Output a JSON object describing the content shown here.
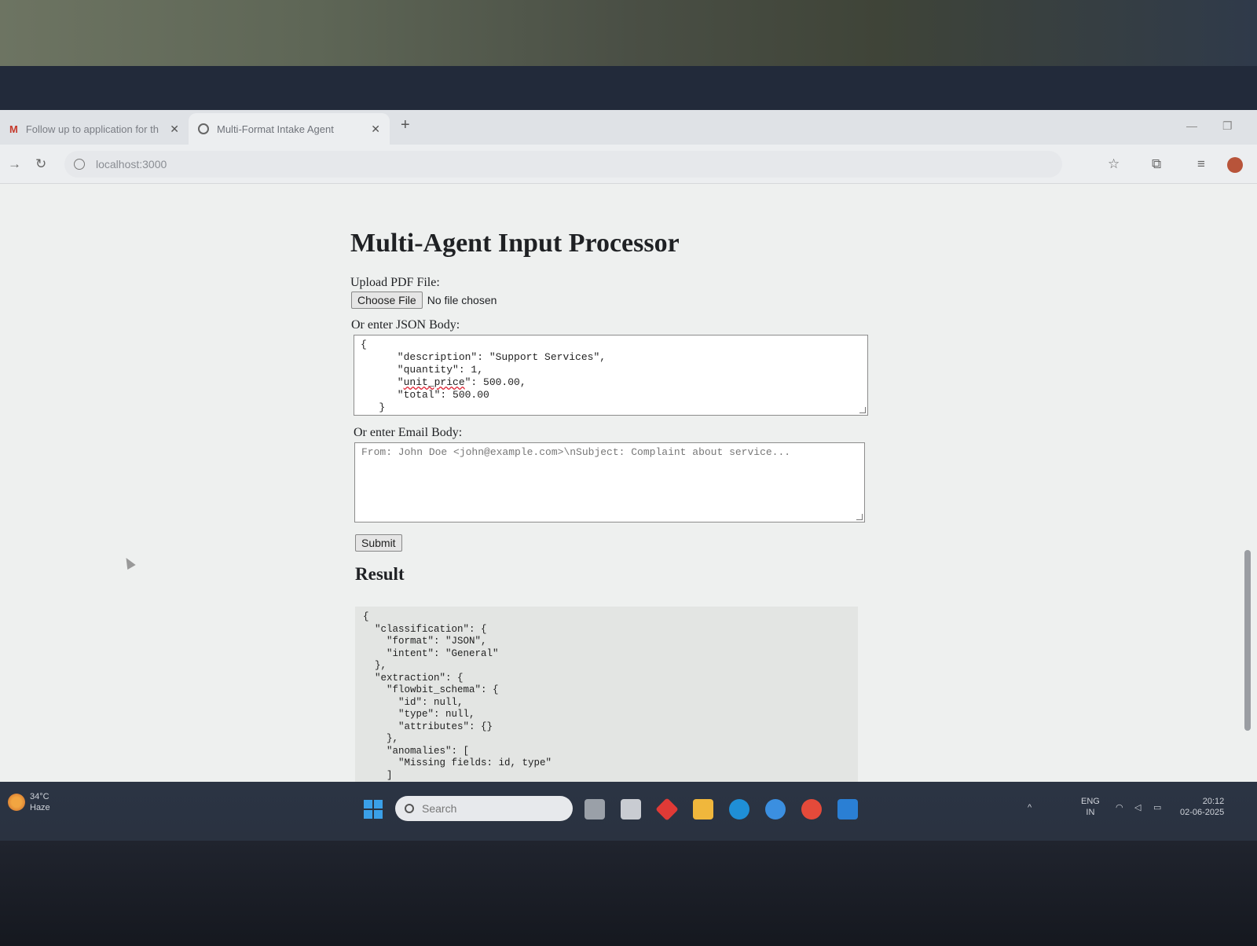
{
  "browser": {
    "tabs": [
      {
        "label": "Follow up to application for th",
        "icon": "gmail-icon",
        "close": "✕"
      },
      {
        "label": "Multi-Format Intake Agent",
        "icon": "globe-icon",
        "close": "✕"
      }
    ],
    "new_tab": "+",
    "url": "localhost:3000"
  },
  "page": {
    "title": "Multi-Agent Input Processor",
    "pdf_label": "Upload PDF File:",
    "choose_file_button": "Choose File",
    "file_status": "No file chosen",
    "json_label": "Or enter JSON Body:",
    "json_value_lines": [
      "{",
      "      \"description\": \"Support Services\",",
      "      \"quantity\": 1,",
      "      \"total\": 500.00",
      "   }"
    ],
    "json_line_unit_price_key": "unit_price",
    "json_line_unit_price_prefix": "      \"",
    "json_line_unit_price_suffix": "\": 500.00,",
    "email_label": "Or enter Email Body:",
    "email_placeholder": "From: John Doe <john@example.com>\\nSubject: Complaint about service...",
    "submit_button": "Submit",
    "result_title": "Result",
    "result_text": "{\n  \"classification\": {\n    \"format\": \"JSON\",\n    \"intent\": \"General\"\n  },\n  \"extraction\": {\n    \"flowbit_schema\": {\n      \"id\": null,\n      \"type\": null,\n      \"attributes\": {}\n    },\n    \"anomalies\": [\n      \"Missing fields: id, type\"\n    ]"
  },
  "taskbar": {
    "weather_temp": "34°C",
    "weather_desc": "Haze",
    "search_placeholder": "Search",
    "lang": "ENG",
    "region": "IN",
    "time": "20:12",
    "date": "02-06-2025",
    "colors": {
      "start": "#3aa0e8",
      "bar": "#2b3444"
    }
  }
}
